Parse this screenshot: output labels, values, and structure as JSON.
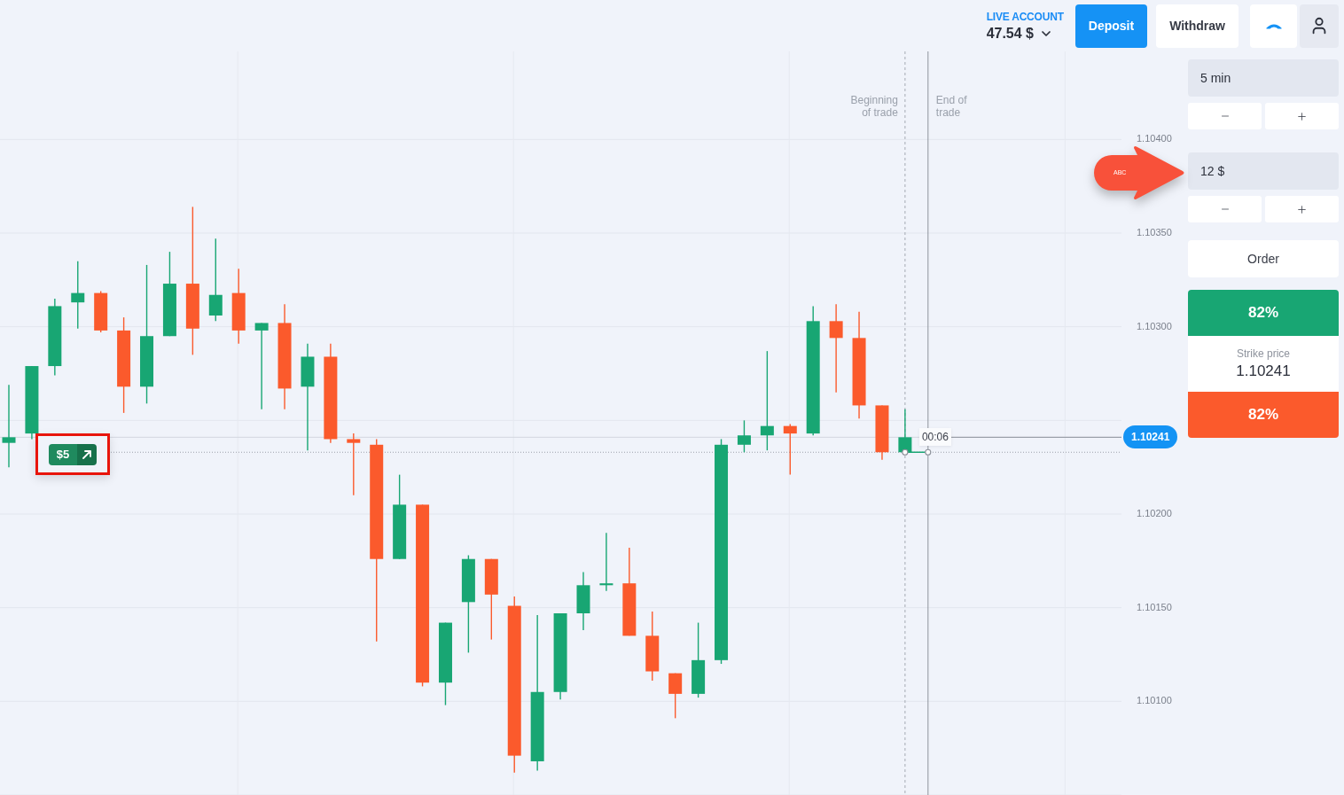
{
  "header": {
    "account": {
      "label": "LIVE ACCOUNT",
      "balance": "47.54 $"
    },
    "buttons": [
      {
        "kind": "primary",
        "label": "Deposit"
      },
      {
        "kind": "secondary",
        "label": "Withdraw"
      }
    ]
  },
  "chart": {
    "trade_start_label": "Beginning of trade",
    "trade_end_label": "End of trade",
    "price_axis": [
      "1.10400",
      "1.10350",
      "1.10300",
      "1.10200",
      "1.10150",
      "1.10100"
    ],
    "timer": "00:06",
    "current_price": "1.10241",
    "trade_marker": {
      "amount": "$5",
      "highlighted": true
    },
    "annotation": {
      "label": "ABC"
    }
  },
  "panel": {
    "duration": "5 min",
    "amount": "12 $",
    "order_button": "Order",
    "up_button": "82%",
    "strike_label": "Strike price",
    "strike_value": "1.10241",
    "down_button": "82%"
  }
}
